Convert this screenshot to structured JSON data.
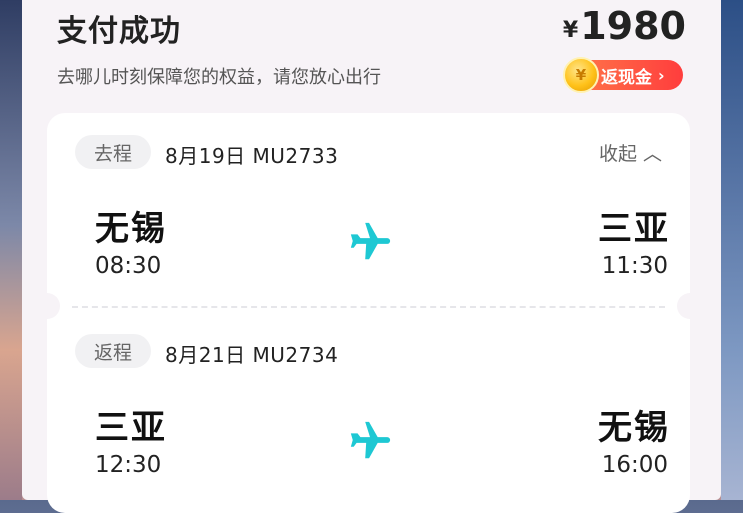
{
  "header": {
    "title": "支付成功",
    "subtitle": "去哪儿时刻保障您的权益，请您放心出行",
    "price_symbol": "¥",
    "price": "1980",
    "cashback_label": "返现金",
    "cashback_chevron": "›",
    "coin_glyph": "¥"
  },
  "outbound": {
    "tag": "去程",
    "date_flight": "8月19日 MU2733",
    "collapse_label": "收起 ︿",
    "from_city": "无锡",
    "from_time": "08:30",
    "to_city": "三亚",
    "to_time": "11:30"
  },
  "return": {
    "tag": "返程",
    "date_flight": "8月21日 MU2734",
    "from_city": "三亚",
    "from_time": "12:30",
    "to_city": "无锡",
    "to_time": "16:00"
  },
  "colors": {
    "accent_plane": "#1ec8d3",
    "cashback_start": "#ff7a4a",
    "cashback_end": "#ff3d3d"
  },
  "icons": [
    "airplane-icon",
    "coin-icon",
    "chevron-right-icon",
    "chevron-up-icon"
  ]
}
